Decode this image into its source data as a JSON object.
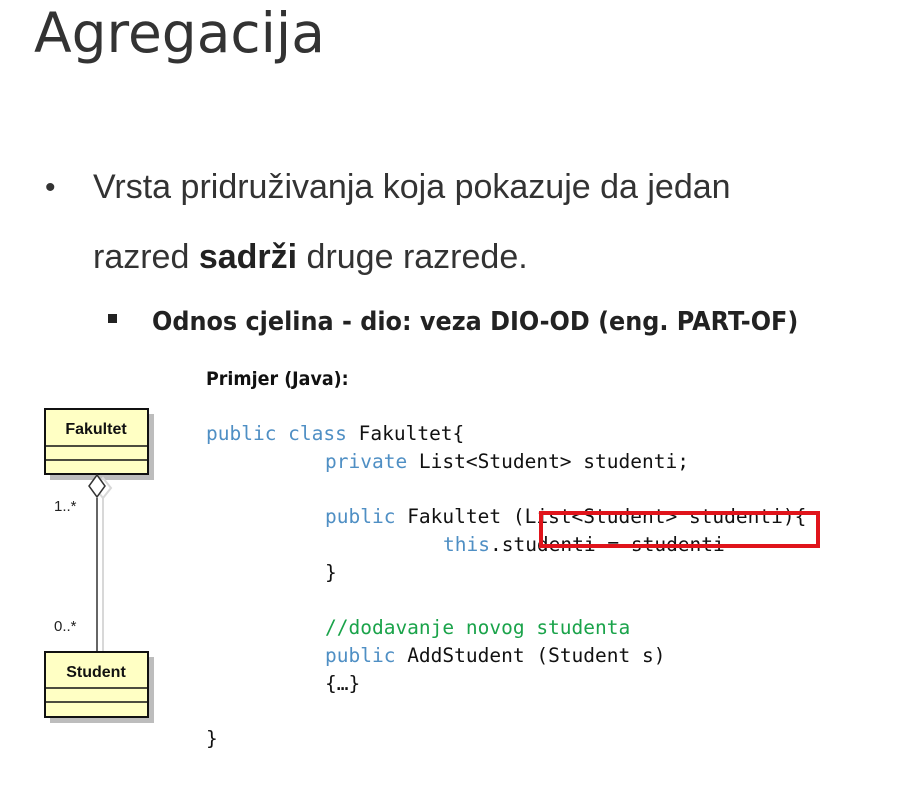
{
  "slide": {
    "title": "Agregacija",
    "bullet": {
      "marker": "•",
      "line1": "Vrsta pridruživanja koja pokazuje da jedan",
      "line2_pre": "razred ",
      "line2_bold": "sadrži",
      "line2_post": " druge razrede."
    },
    "sub_bullet": "Odnos cjelina - dio: veza DIO-OD (eng. PART-OF)",
    "example_heading": "Primjer (Java):"
  },
  "code": {
    "l1_kw": "public class",
    "l1_rest": " Fakultet{",
    "l2_kw": "private",
    "l2_rest": " List<Student> studenti;",
    "l3_kw": "public",
    "l3_rest": " Fakultet (List<Student> studenti){",
    "l4_kw": "this",
    "l4_rest": ".studenti = studenti",
    "l5": "}",
    "l6_comment": "//dodavanje novog studenta",
    "l7_kw": "public",
    "l7_rest": " AddStudent (Student s)",
    "l8": "{…}",
    "l9": "}"
  },
  "uml": {
    "class_top": "Fakultet",
    "class_bottom": "Student",
    "mult_top": "1..*",
    "mult_bottom": "0..*"
  },
  "colors": {
    "keyword": "#4f8fc4",
    "comment": "#1aa34a",
    "highlight_box": "#e0141b",
    "uml_fill": "#ffffc4"
  }
}
